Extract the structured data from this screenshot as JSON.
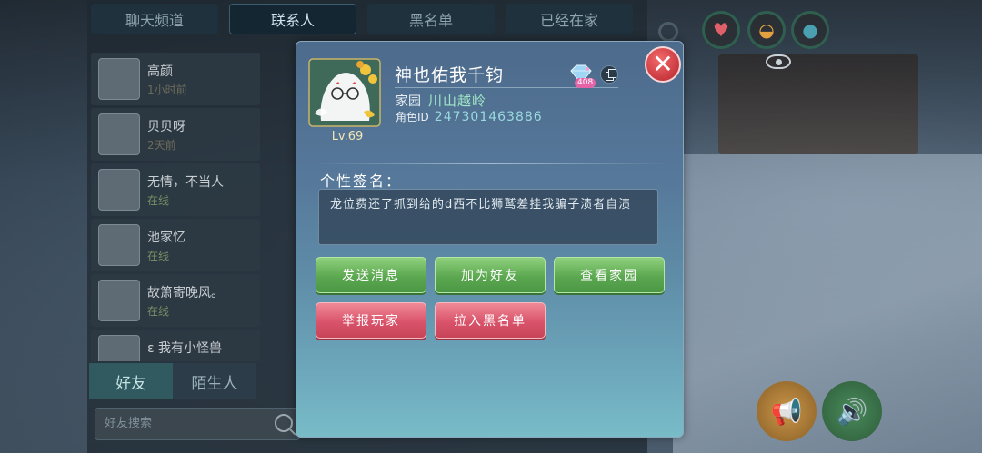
{
  "background_tabs": [
    {
      "label": "聊天频道"
    },
    {
      "label": "联系人"
    },
    {
      "label": "黑名单"
    },
    {
      "label": "已经在家"
    }
  ],
  "friend_list": [
    {
      "name": "高颜",
      "status": "1小时前"
    },
    {
      "name": "贝贝呀",
      "status": "2天前"
    },
    {
      "name": "无情，不当人",
      "status": "在线"
    },
    {
      "name": "池家忆",
      "status": "在线"
    },
    {
      "name": "故箫寄晚风。",
      "status": "在线"
    },
    {
      "name": "ε 我有小怪兽",
      "status": ""
    }
  ],
  "bottom_tabs": [
    {
      "label": "好友"
    },
    {
      "label": "陌生人"
    }
  ],
  "search": {
    "placeholder": "好友搜索"
  },
  "profile": {
    "name": "神也佑我千钧",
    "level": "Lv.69",
    "home_label": "家园",
    "home_value": "川山越岭",
    "role_id_label": "角色ID",
    "role_id_value": "247301463886",
    "badge_count": "408",
    "signature_label": "个性签名：",
    "signature": "龙位费还了抓到给的d西不比狮鹫差挂我骗子渍者自渍"
  },
  "actions": {
    "send_message": "发送消息",
    "add_friend": "加为好友",
    "view_home": "查看家园",
    "report_player": "举报玩家",
    "blacklist": "拉入黑名单"
  },
  "close": {
    "label": "✕"
  },
  "colors": {
    "accent_green": "#5ca851",
    "accent_red": "#d9536a",
    "close_red": "#c8383f"
  }
}
